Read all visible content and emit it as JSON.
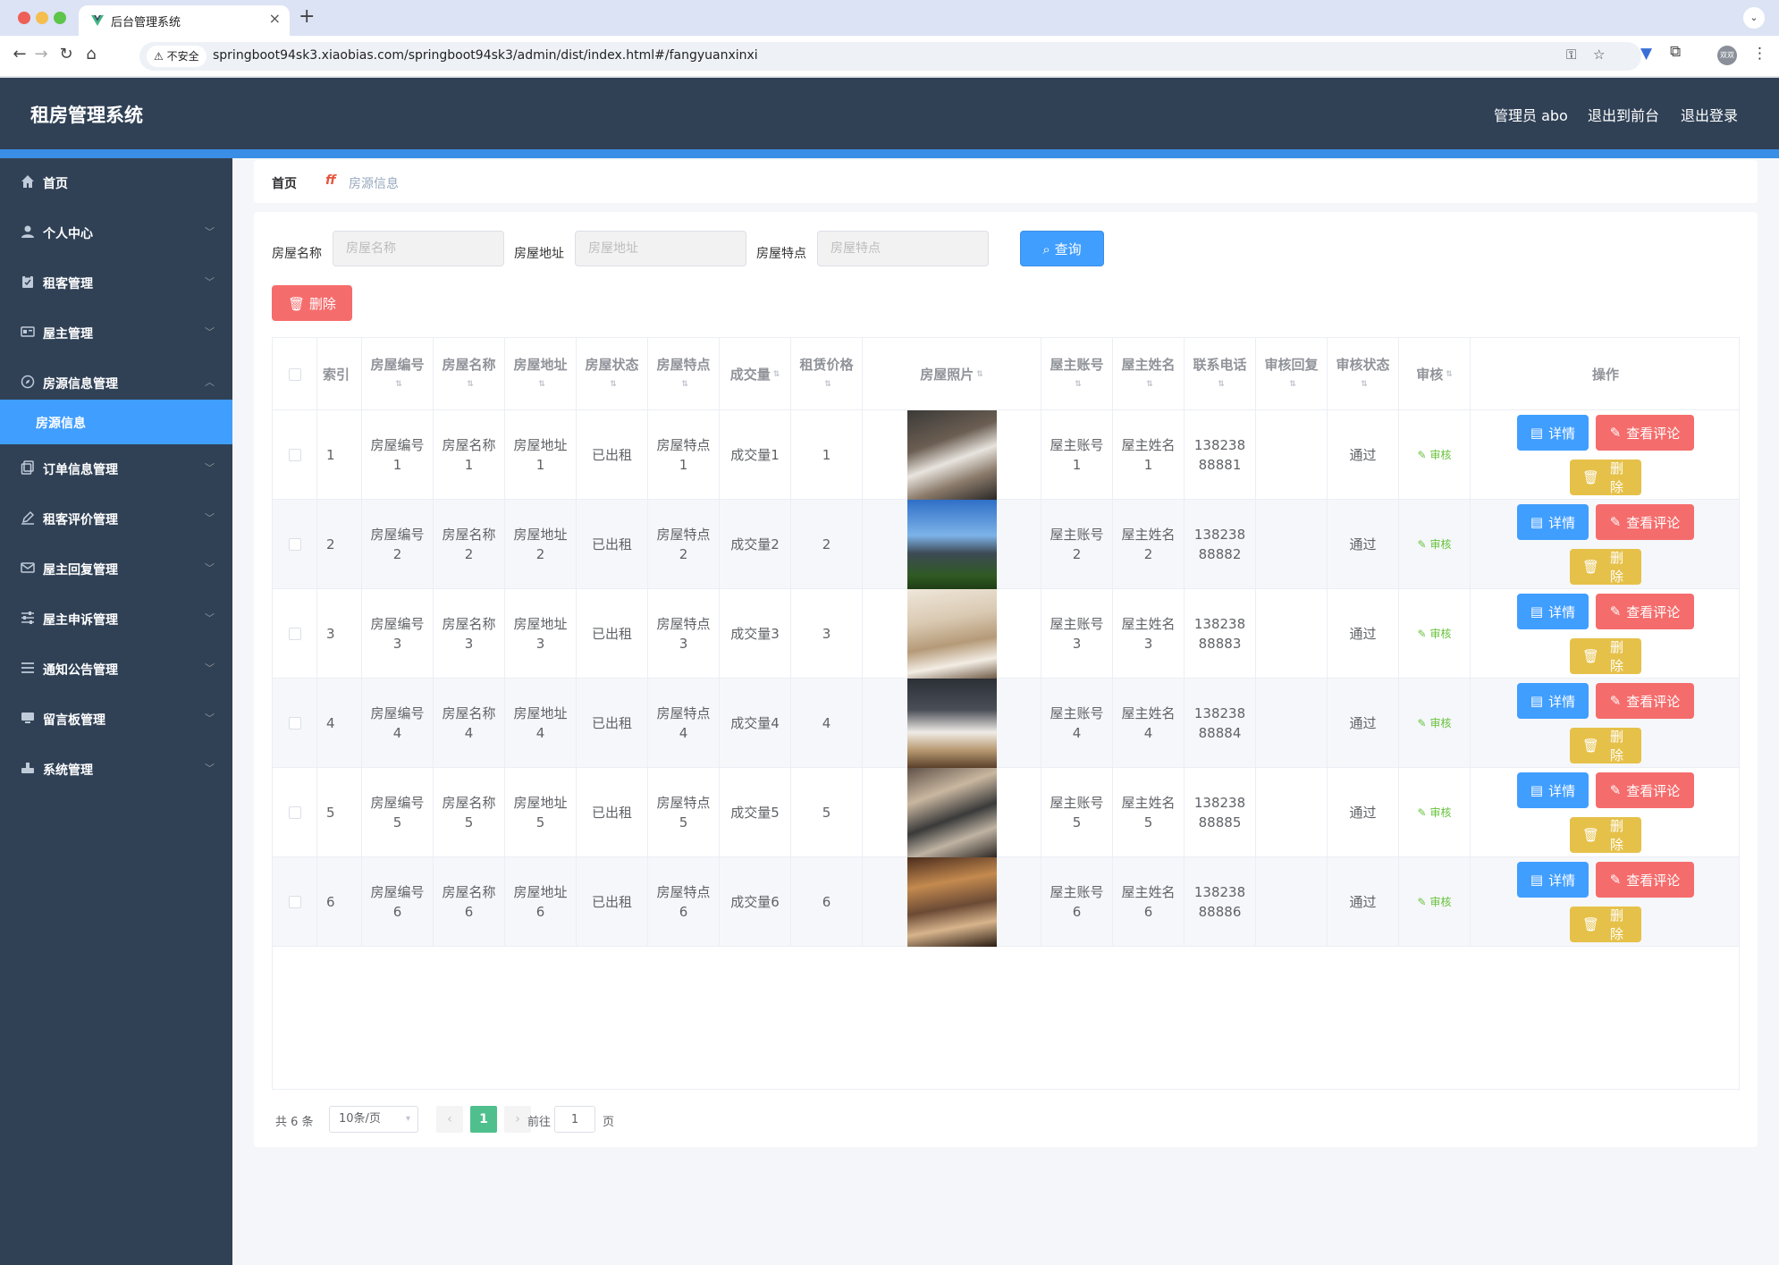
{
  "browser": {
    "tab_title": "后台管理系统",
    "security_label": "不安全",
    "url": "springboot94sk3.xiaobias.com/springboot94sk3/admin/dist/index.html#/fangyuanxinxi",
    "avatar_text": "双双"
  },
  "header": {
    "app_title": "租房管理系统",
    "user_label": "管理员 abo",
    "back_front_label": "退出到前台",
    "logout_label": "退出登录"
  },
  "sidebar": {
    "items": [
      {
        "label": "首页",
        "icon": "home-icon"
      },
      {
        "label": "个人中心",
        "icon": "user-icon"
      },
      {
        "label": "租客管理",
        "icon": "clipboard-icon"
      },
      {
        "label": "屋主管理",
        "icon": "id-card-icon"
      },
      {
        "label": "房源信息管理",
        "icon": "compass-icon",
        "expanded": true
      },
      {
        "label": "订单信息管理",
        "icon": "copy-icon"
      },
      {
        "label": "租客评价管理",
        "icon": "pen-icon"
      },
      {
        "label": "屋主回复管理",
        "icon": "mail-icon"
      },
      {
        "label": "屋主申诉管理",
        "icon": "sliders-icon"
      },
      {
        "label": "通知公告管理",
        "icon": "list-icon"
      },
      {
        "label": "留言板管理",
        "icon": "monitor-icon"
      },
      {
        "label": "系统管理",
        "icon": "stamp-icon"
      }
    ],
    "active_sub": "房源信息"
  },
  "breadcrumb": {
    "home": "首页",
    "separator": "ff",
    "current": "房源信息"
  },
  "search": {
    "name_label": "房屋名称",
    "name_placeholder": "房屋名称",
    "address_label": "房屋地址",
    "address_placeholder": "房屋地址",
    "feature_label": "房屋特点",
    "feature_placeholder": "房屋特点",
    "query_label": "查询",
    "batch_delete_label": "删除"
  },
  "table": {
    "columns": [
      "索引",
      "房屋编号",
      "房屋名称",
      "房屋地址",
      "房屋状态",
      "房屋特点",
      "成交量",
      "租赁价格",
      "房屋照片",
      "屋主账号",
      "屋主姓名",
      "联系电话",
      "审核回复",
      "审核状态",
      "审核",
      "操作"
    ],
    "rows": [
      {
        "index": "1",
        "house_no": "房屋编号1",
        "name": "房屋名称1",
        "address": "房屋地址1",
        "status": "已出租",
        "feature": "房屋特点1",
        "volume": "成交量1",
        "price": "1",
        "owner_account": "屋主账号1",
        "owner_name": "屋主姓名1",
        "phone": "13823888881",
        "reply": "",
        "audit_status": "通过"
      },
      {
        "index": "2",
        "house_no": "房屋编号2",
        "name": "房屋名称2",
        "address": "房屋地址2",
        "status": "已出租",
        "feature": "房屋特点2",
        "volume": "成交量2",
        "price": "2",
        "owner_account": "屋主账号2",
        "owner_name": "屋主姓名2",
        "phone": "13823888882",
        "reply": "",
        "audit_status": "通过"
      },
      {
        "index": "3",
        "house_no": "房屋编号3",
        "name": "房屋名称3",
        "address": "房屋地址3",
        "status": "已出租",
        "feature": "房屋特点3",
        "volume": "成交量3",
        "price": "3",
        "owner_account": "屋主账号3",
        "owner_name": "屋主姓名3",
        "phone": "13823888883",
        "reply": "",
        "audit_status": "通过"
      },
      {
        "index": "4",
        "house_no": "房屋编号4",
        "name": "房屋名称4",
        "address": "房屋地址4",
        "status": "已出租",
        "feature": "房屋特点4",
        "volume": "成交量4",
        "price": "4",
        "owner_account": "屋主账号4",
        "owner_name": "屋主姓名4",
        "phone": "13823888884",
        "reply": "",
        "audit_status": "通过"
      },
      {
        "index": "5",
        "house_no": "房屋编号5",
        "name": "房屋名称5",
        "address": "房屋地址5",
        "status": "已出租",
        "feature": "房屋特点5",
        "volume": "成交量5",
        "price": "5",
        "owner_account": "屋主账号5",
        "owner_name": "屋主姓名5",
        "phone": "13823888885",
        "reply": "",
        "audit_status": "通过"
      },
      {
        "index": "6",
        "house_no": "房屋编号6",
        "name": "房屋名称6",
        "address": "房屋地址6",
        "status": "已出租",
        "feature": "房屋特点6",
        "volume": "成交量6",
        "price": "6",
        "owner_account": "屋主账号6",
        "owner_name": "屋主姓名6",
        "phone": "13823888886",
        "reply": "",
        "audit_status": "通过"
      }
    ],
    "audit_label": "审核",
    "detail_label": "详情",
    "review_label": "查看评论",
    "delete_label": "删除"
  },
  "pagination": {
    "total": "共 6 条",
    "page_size": "10条/页",
    "current_page": "1",
    "goto_label": "前往",
    "goto_value": "1",
    "page_unit": "页"
  },
  "colors": {
    "header_bg": "#304156",
    "accent": "#409eff",
    "danger": "#f56c6c",
    "warning": "#e6c14a",
    "success": "#4fc08d"
  }
}
